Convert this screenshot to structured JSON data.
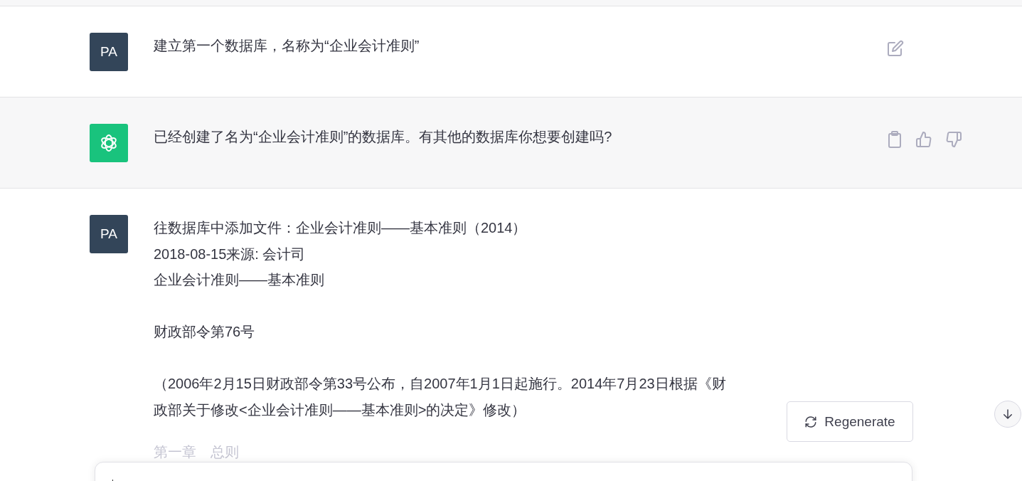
{
  "messages": [
    {
      "kind": "user",
      "avatar": "PA",
      "paragraphs": [
        [
          "建立第一个数据库，名称为“企业会计准则”"
        ]
      ],
      "actions_visible": true
    },
    {
      "kind": "assistant",
      "paragraphs": [
        [
          "已经创建了名为“企业会计准则”的数据库。有其他的数据库你想要创建吗?"
        ]
      ],
      "actions_visible": true
    },
    {
      "kind": "user",
      "avatar": "PA",
      "paragraphs": [
        [
          "往数据库中添加文件：企业会计准则——基本准则（2014）",
          "2018-08-15来源: 会计司",
          "企业会计准则——基本准则"
        ],
        [
          "财政部令第76号"
        ],
        [
          "（2006年2月15日财政部令第33号公布，自2007年1月1日起施行。2014年7月23日根据《财",
          "政部关于修改<企业会计准则——基本准则>的决定》修改）"
        ],
        [
          "第一章　总则"
        ]
      ],
      "actions_visible": false
    }
  ],
  "regenerate_button": "Regenerate"
}
